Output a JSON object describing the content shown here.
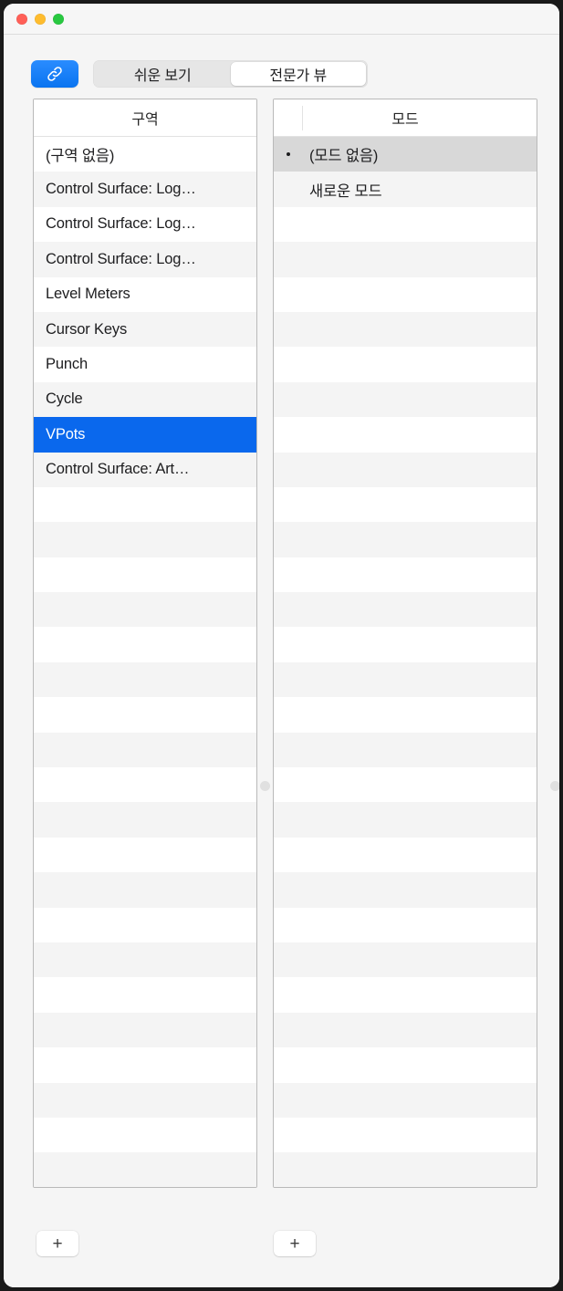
{
  "window": {
    "traffic_lights": [
      {
        "name": "close",
        "color": "#ff5f57"
      },
      {
        "name": "minimize",
        "color": "#febc2e"
      },
      {
        "name": "zoom",
        "color": "#28c840"
      }
    ]
  },
  "toolbar": {
    "link_button": {
      "icon": "link-icon",
      "accent_color": "#0a74f0"
    },
    "segmented_control": {
      "selected_index": 1,
      "options": [
        {
          "label": "쉬운 보기"
        },
        {
          "label": "전문가 뷰"
        }
      ]
    }
  },
  "zone_pane": {
    "header": "구역",
    "add_button_label": "+",
    "selected_index": 8,
    "total_rows": 30,
    "items": [
      {
        "label": "(구역 없음)"
      },
      {
        "label": "Control Surface: Log…"
      },
      {
        "label": "Control Surface: Log…"
      },
      {
        "label": "Control Surface: Log…"
      },
      {
        "label": "Level Meters"
      },
      {
        "label": "Cursor Keys"
      },
      {
        "label": "Punch"
      },
      {
        "label": "Cycle"
      },
      {
        "label": "VPots"
      },
      {
        "label": "Control Surface: Art…"
      }
    ]
  },
  "mode_pane": {
    "header": "모드",
    "add_button_label": "+",
    "selected_index": 0,
    "total_rows": 30,
    "items": [
      {
        "label": "(모드 없음)",
        "bullet": true
      },
      {
        "label": "새로운 모드",
        "bullet": false
      }
    ]
  },
  "colors": {
    "selection_active": "#0a68ed",
    "selection_inactive": "#d8d8d8",
    "stripe": "#f4f4f4",
    "window_bg": "#f5f5f5"
  }
}
